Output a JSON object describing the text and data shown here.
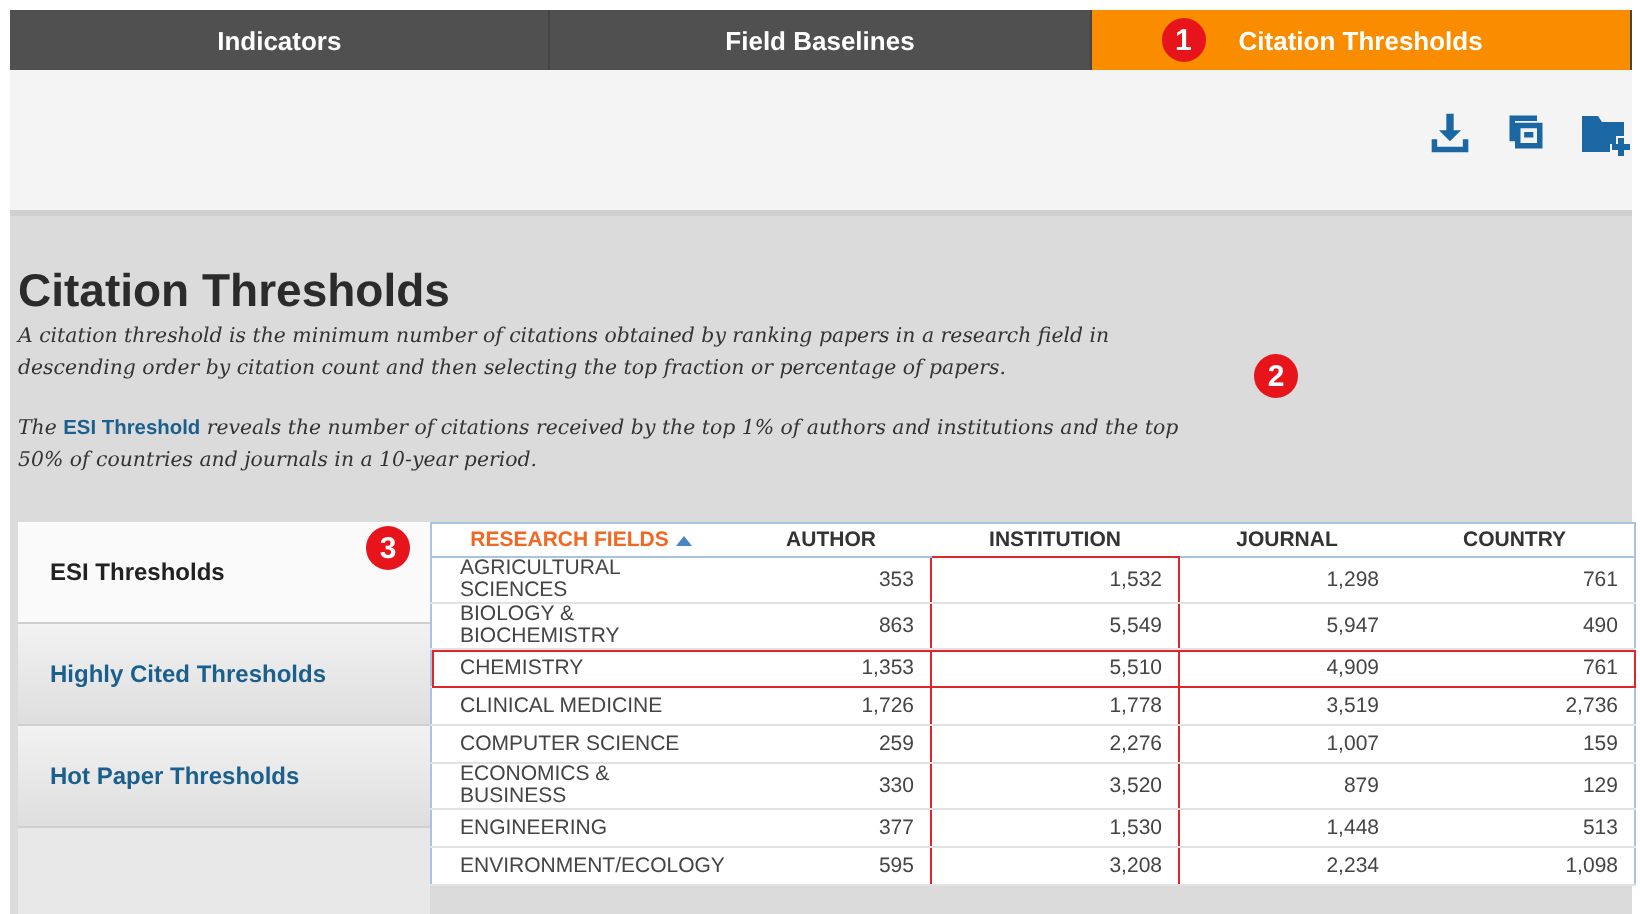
{
  "tabs": [
    {
      "label": "Indicators",
      "selected": false
    },
    {
      "label": "Field Baselines",
      "selected": false
    },
    {
      "label": "Citation Thresholds",
      "selected": true,
      "callout": "1"
    }
  ],
  "heading": "Citation Thresholds",
  "intro": "A citation threshold is the minimum number of citations obtained by ranking papers in a research field in descending order by citation count and then selecting the top fraction or percentage of papers.",
  "esi_note": {
    "link": "ESI Threshold",
    "before": "The",
    "after": "reveals the number of citations received by the top 1% of authors and institutions and the top 50% of countries and journals in a 10-year period.",
    "callout": "2"
  },
  "sidebar": {
    "callout": "3",
    "items": [
      {
        "label": "ESI Thresholds",
        "selected": true
      },
      {
        "label": "Highly Cited Thresholds",
        "selected": false
      },
      {
        "label": "Hot Paper Thresholds",
        "selected": false
      }
    ]
  },
  "table": {
    "columns": [
      {
        "label": "RESEARCH FIELDS",
        "sorted": true,
        "highlighted": false
      },
      {
        "label": "AUTHOR",
        "sorted": false,
        "highlighted": false
      },
      {
        "label": "INSTITUTION",
        "sorted": false,
        "highlighted": true
      },
      {
        "label": "JOURNAL",
        "sorted": false,
        "highlighted": false
      },
      {
        "label": "COUNTRY",
        "sorted": false,
        "highlighted": false
      }
    ],
    "rows": [
      {
        "cells": [
          "AGRICULTURAL SCIENCES",
          "353",
          "1,532",
          "1,298",
          "761"
        ],
        "highlighted": false
      },
      {
        "cells": [
          "BIOLOGY & BIOCHEMISTRY",
          "863",
          "5,549",
          "5,947",
          "490"
        ],
        "highlighted": false
      },
      {
        "cells": [
          "CHEMISTRY",
          "1,353",
          "5,510",
          "4,909",
          "761"
        ],
        "highlighted": true
      },
      {
        "cells": [
          "CLINICAL MEDICINE",
          "1,726",
          "1,778",
          "3,519",
          "2,736"
        ],
        "highlighted": false
      },
      {
        "cells": [
          "COMPUTER SCIENCE",
          "259",
          "2,276",
          "1,007",
          "159"
        ],
        "highlighted": false
      },
      {
        "cells": [
          "ECONOMICS & BUSINESS",
          "330",
          "3,520",
          "879",
          "129"
        ],
        "highlighted": false
      },
      {
        "cells": [
          "ENGINEERING",
          "377",
          "1,530",
          "1,448",
          "513"
        ],
        "highlighted": false
      },
      {
        "cells": [
          "ENVIRONMENT/ECOLOGY",
          "595",
          "3,208",
          "2,234",
          "1,098"
        ],
        "highlighted": false
      }
    ]
  }
}
